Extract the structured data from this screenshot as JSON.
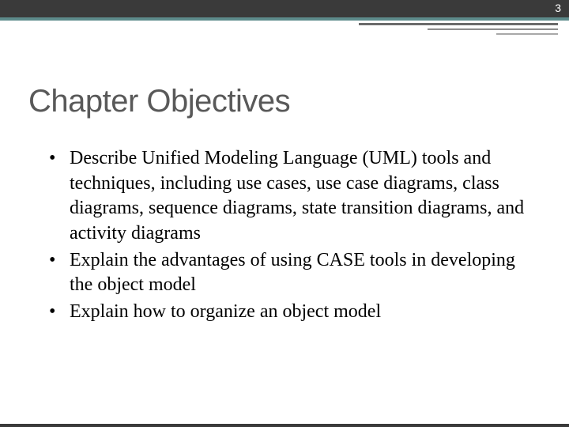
{
  "page_number": "3",
  "title": "Chapter Objectives",
  "objectives": [
    "Describe Unified Modeling Language (UML) tools and techniques, including use cases, use case diagrams, class diagrams, sequence diagrams, state transition diagrams, and activity diagrams",
    "Explain the advantages of using CASE tools in developing the object model",
    "Explain how to organize an object model"
  ]
}
